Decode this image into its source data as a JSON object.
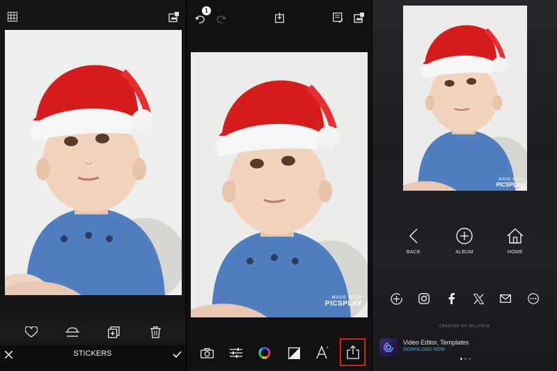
{
  "panel1": {
    "title": "STICKERS",
    "icons": [
      "grid-icon",
      "edit-photo-icon",
      "heart-icon",
      "flip-icon",
      "layer-add-icon",
      "trash-icon",
      "close-icon",
      "check-icon"
    ]
  },
  "panel2": {
    "undo_count": "1",
    "watermark_small": "MADE WITH",
    "watermark_big": "PICSPLAY",
    "icons": [
      "undo-icon",
      "redo-icon",
      "save-icon",
      "layers-icon",
      "edit-photo-icon",
      "camera-icon",
      "adjust-icon",
      "color-wheel-icon",
      "tone-icon",
      "text-icon",
      "share-icon"
    ],
    "highlight_color": "#d32020"
  },
  "panel3": {
    "watermark_small": "MADE WITH",
    "watermark_big": "PICSPLAY",
    "nav": {
      "back": "BACK",
      "album": "ALBUM",
      "home": "HOME"
    },
    "share_icons": [
      "add-circle-icon",
      "instagram-icon",
      "facebook-icon",
      "x-icon",
      "mail-icon",
      "more-icon"
    ],
    "created_by": "CREATED BY JELLYBUS",
    "promo": {
      "title": "Video Editor, Templates",
      "action": "DOWNLOAD NOW"
    }
  }
}
